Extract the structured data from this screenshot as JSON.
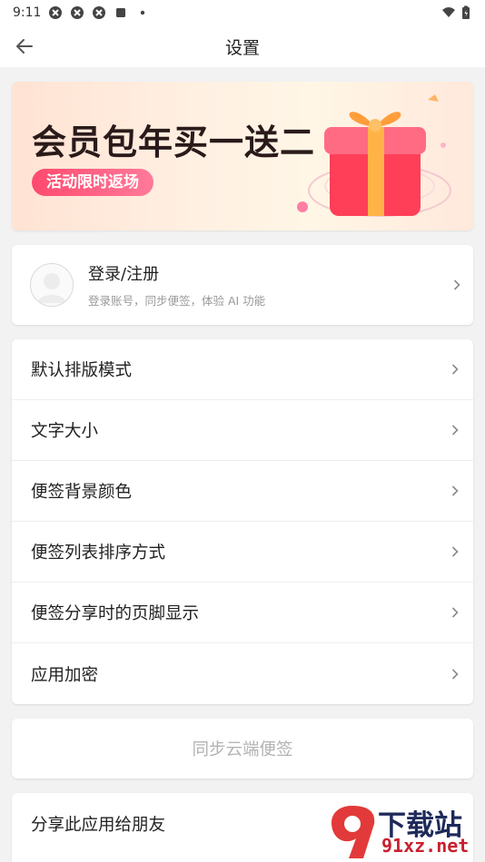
{
  "status_bar": {
    "time": "9:11",
    "icons": [
      "sync-icon",
      "sync-icon",
      "sync-icon",
      "stop-icon",
      "dot-icon"
    ],
    "right_icons": [
      "wifi-icon",
      "battery-icon"
    ]
  },
  "app_bar": {
    "title": "设置",
    "back_icon": "arrow-left-icon"
  },
  "banner": {
    "title": "会员包年买一送二",
    "pill": "活动限时返场"
  },
  "account": {
    "title": "登录/注册",
    "subtitle": "登录账号，同步便签，体验 AI 功能"
  },
  "settings_list": [
    {
      "label": "默认排版模式"
    },
    {
      "label": "文字大小"
    },
    {
      "label": "便签背景颜色"
    },
    {
      "label": "便签列表排序方式"
    },
    {
      "label": "便签分享时的页脚显示"
    },
    {
      "label": "应用加密"
    }
  ],
  "sync": {
    "label": "同步云端便签"
  },
  "share": {
    "label": "分享此应用给朋友"
  },
  "watermark": {
    "text": "下载站",
    "url": "91xz.net"
  }
}
